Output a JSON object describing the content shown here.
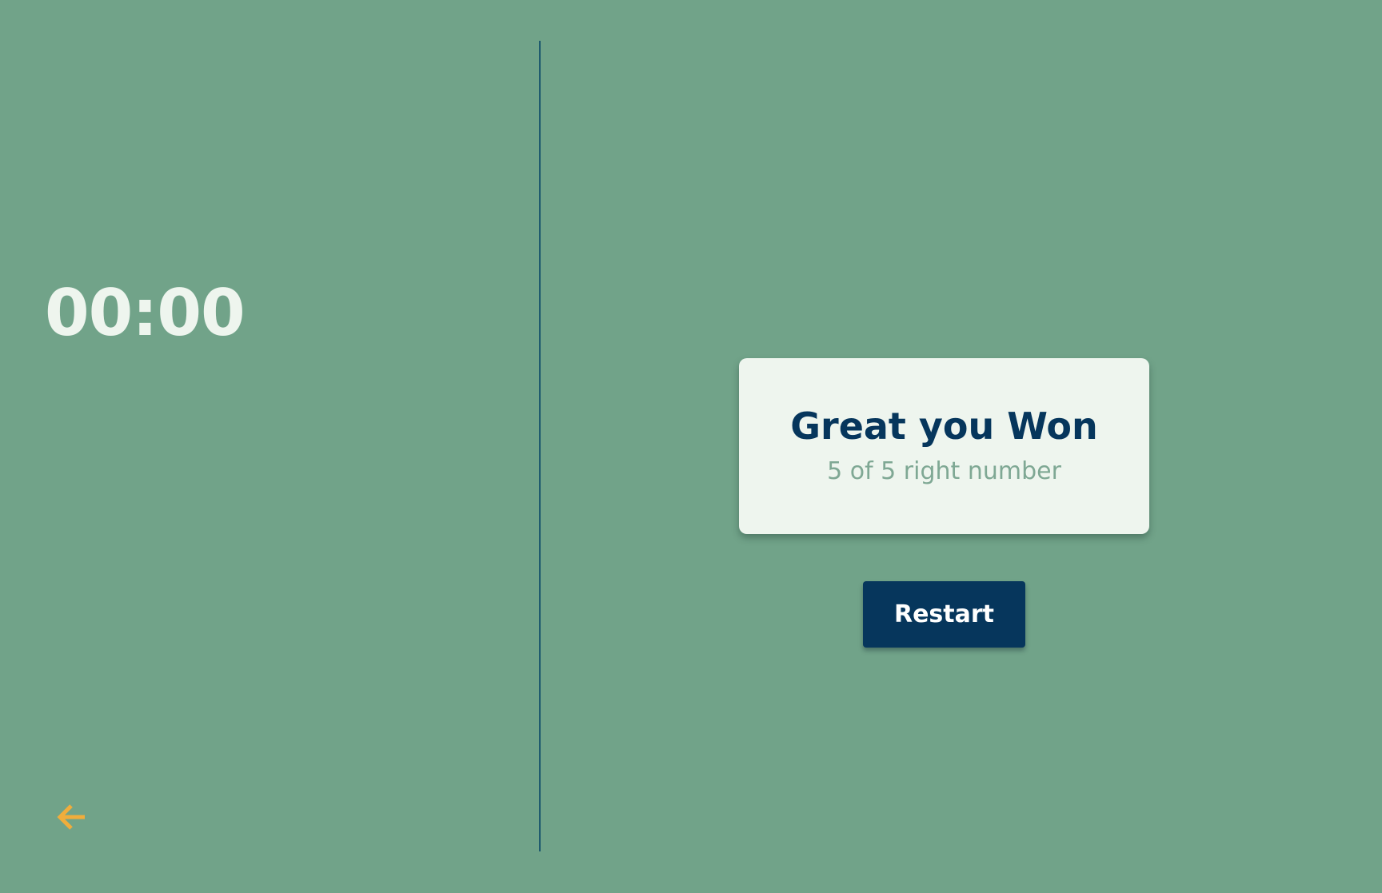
{
  "timer": {
    "value": "00:00"
  },
  "navigation": {
    "back_icon": "arrow-left-icon"
  },
  "result": {
    "title": "Great you Won",
    "subtitle": "5 of 5 right number"
  },
  "actions": {
    "restart_label": "Restart"
  },
  "colors": {
    "background": "#71a389",
    "timer_text": "#eef5ee",
    "divider": "#1f5b6e",
    "card_background": "#eef5ee",
    "title_text": "#06365c",
    "subtitle_text": "#7fa894",
    "button_background": "#06365c",
    "back_icon": "#f0ad3c"
  }
}
